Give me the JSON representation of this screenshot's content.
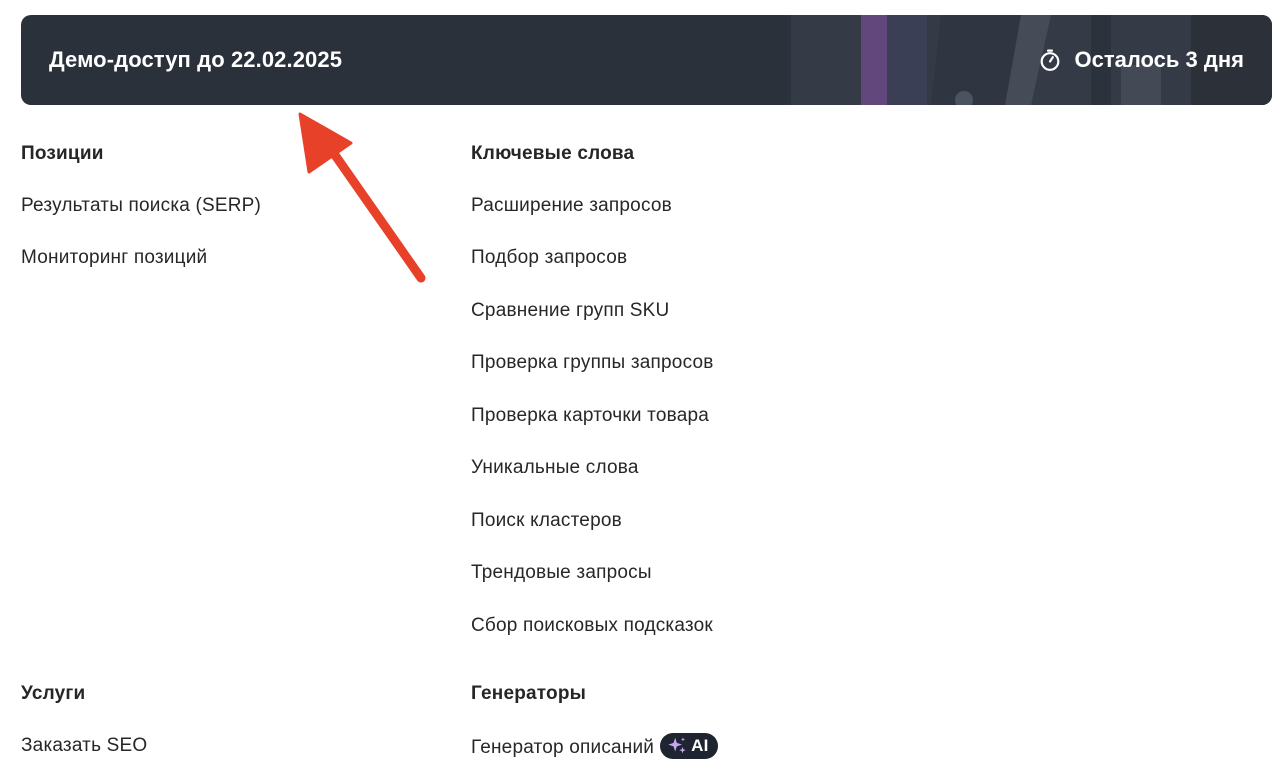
{
  "banner": {
    "title": "Демо-доступ до 22.02.2025",
    "remaining": "Осталось 3 дня"
  },
  "sections": {
    "positions": {
      "title": "Позиции",
      "items": [
        "Результаты поиска (SERP)",
        "Мониторинг позиций"
      ]
    },
    "keywords": {
      "title": "Ключевые слова",
      "items": [
        "Расширение запросов",
        "Подбор запросов",
        "Сравнение групп SKU",
        "Проверка группы запросов",
        "Проверка карточки товара",
        "Уникальные слова",
        "Поиск кластеров",
        "Трендовые запросы",
        "Сбор поисковых подсказок"
      ]
    },
    "services": {
      "title": "Услуги",
      "items": [
        "Заказать SEO"
      ]
    },
    "generators": {
      "title": "Генераторы",
      "items": [
        "Генератор описаний"
      ],
      "badge": "AI"
    }
  },
  "colors": {
    "banner_bg": "#2a313b",
    "annotation_arrow": "#e8412a",
    "badge_bg": "#1e2430",
    "sparkle": "#c9a6f2"
  }
}
